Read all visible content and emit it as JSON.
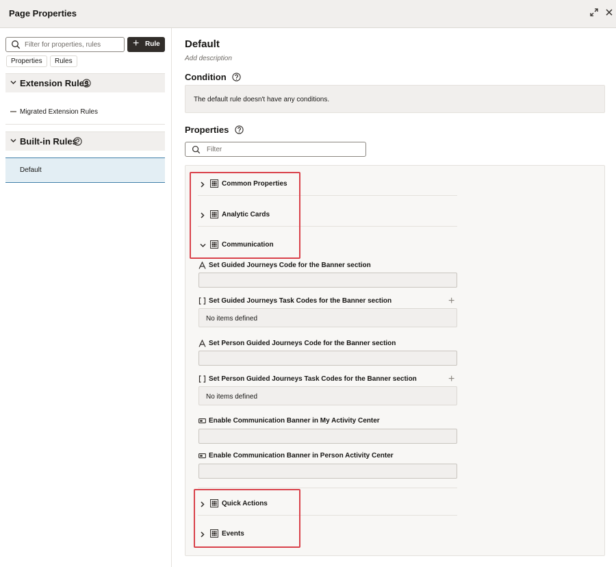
{
  "window": {
    "title": "Page Properties",
    "expand_icon": "expand-icon",
    "close_icon": "close-icon"
  },
  "left": {
    "search_placeholder": "Filter for properties, rules",
    "rule_button": "Rule",
    "chips": {
      "properties": "Properties",
      "rules": "Rules"
    },
    "extension_rules": {
      "title": "Extension Rules",
      "items": [
        "Migrated Extension Rules"
      ]
    },
    "builtin_rules": {
      "title": "Built-in Rules",
      "items": [
        "Default"
      ]
    }
  },
  "main": {
    "title": "Default",
    "description_placeholder": "Add description",
    "condition": {
      "title": "Condition",
      "text": "The default rule doesn't have any conditions."
    },
    "properties": {
      "title": "Properties",
      "filter_placeholder": "Filter",
      "groups": {
        "common": "Common Properties",
        "analytic": "Analytic Cards",
        "communication": "Communication",
        "quick_actions": "Quick Actions",
        "events": "Events"
      },
      "fields": {
        "f1": "Set Guided Journeys Code for the Banner section",
        "f2": "Set Guided Journeys Task Codes for the Banner section",
        "f2_empty": "No items defined",
        "f3": "Set Person Guided Journeys Code for the Banner section",
        "f4": "Set Person Guided Journeys Task Codes for the Banner section",
        "f4_empty": "No items defined",
        "f5": "Enable Communication Banner in My Activity Center",
        "f6": "Enable Communication Banner in Person Activity Center"
      }
    }
  },
  "highlight_color": "#d9414a"
}
